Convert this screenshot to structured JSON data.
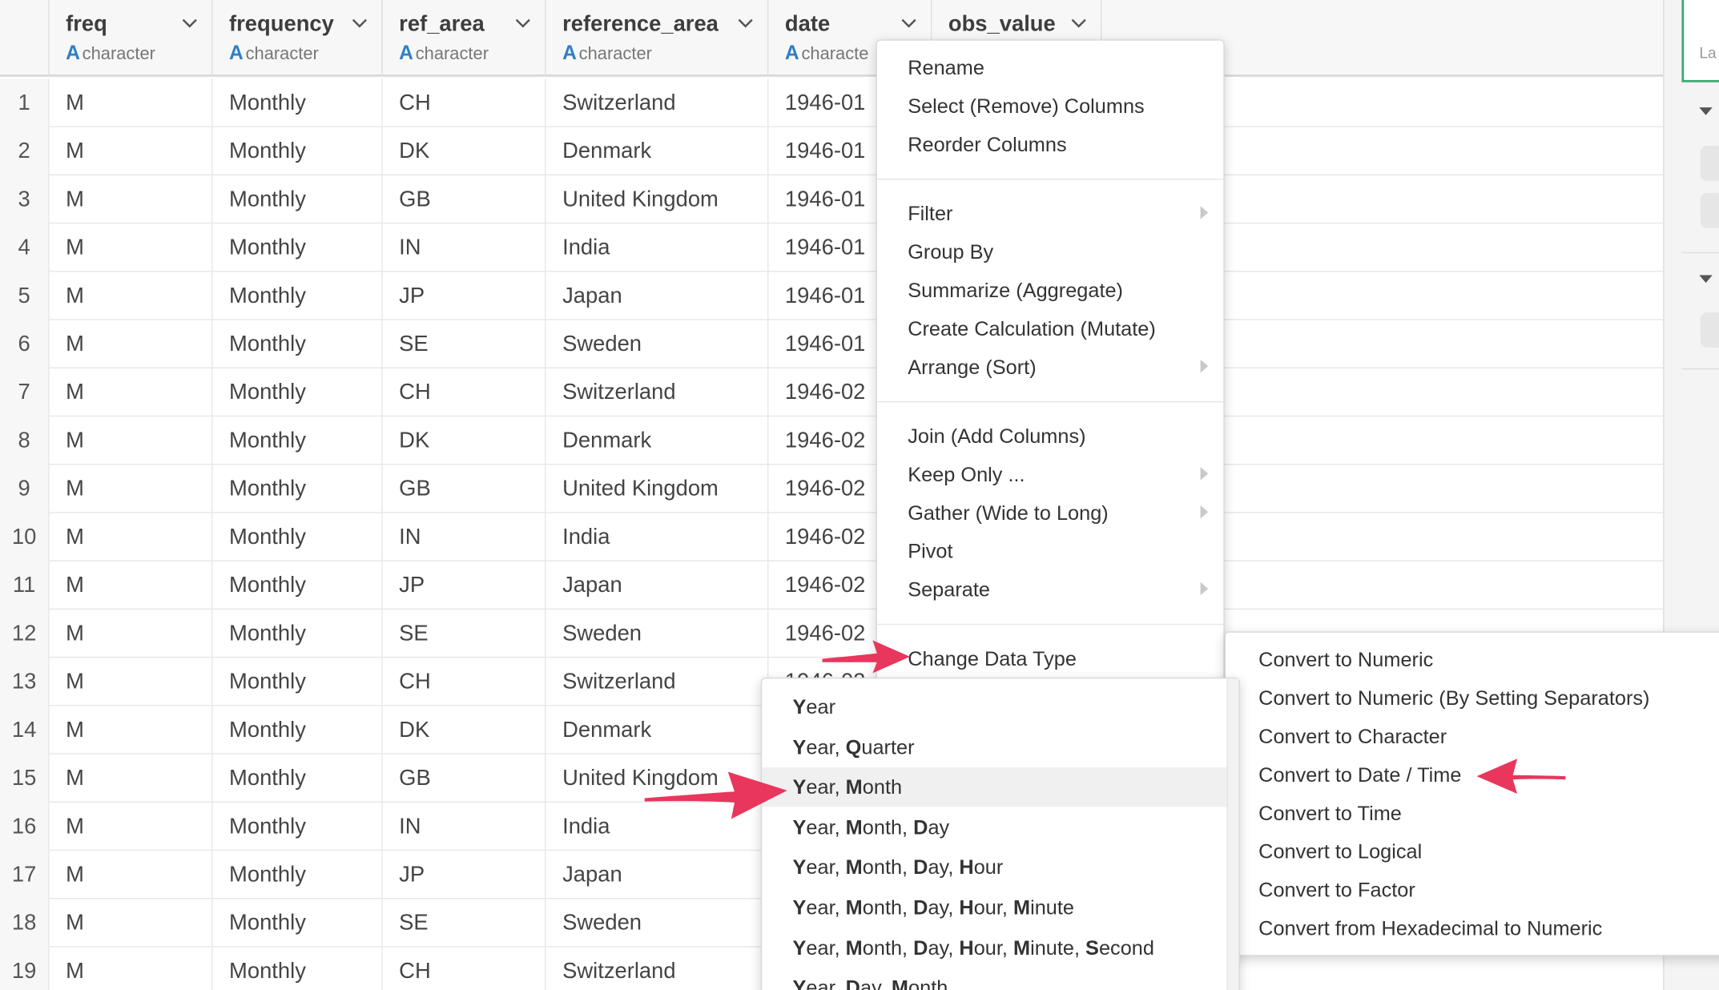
{
  "columns": [
    {
      "name": "freq",
      "type": "character"
    },
    {
      "name": "frequency",
      "type": "character"
    },
    {
      "name": "ref_area",
      "type": "character"
    },
    {
      "name": "reference_area",
      "type": "character"
    },
    {
      "name": "date",
      "type": "characte"
    },
    {
      "name": "obs_value",
      "type": ""
    }
  ],
  "type_glyph": "A",
  "rows": [
    {
      "n": "1",
      "freq": "M",
      "frequency": "Monthly",
      "ref_area": "CH",
      "reference_area": "Switzerland",
      "date": "1946-01"
    },
    {
      "n": "2",
      "freq": "M",
      "frequency": "Monthly",
      "ref_area": "DK",
      "reference_area": "Denmark",
      "date": "1946-01"
    },
    {
      "n": "3",
      "freq": "M",
      "frequency": "Monthly",
      "ref_area": "GB",
      "reference_area": "United Kingdom",
      "date": "1946-01"
    },
    {
      "n": "4",
      "freq": "M",
      "frequency": "Monthly",
      "ref_area": "IN",
      "reference_area": "India",
      "date": "1946-01"
    },
    {
      "n": "5",
      "freq": "M",
      "frequency": "Monthly",
      "ref_area": "JP",
      "reference_area": "Japan",
      "date": "1946-01"
    },
    {
      "n": "6",
      "freq": "M",
      "frequency": "Monthly",
      "ref_area": "SE",
      "reference_area": "Sweden",
      "date": "1946-01"
    },
    {
      "n": "7",
      "freq": "M",
      "frequency": "Monthly",
      "ref_area": "CH",
      "reference_area": "Switzerland",
      "date": "1946-02"
    },
    {
      "n": "8",
      "freq": "M",
      "frequency": "Monthly",
      "ref_area": "DK",
      "reference_area": "Denmark",
      "date": "1946-02"
    },
    {
      "n": "9",
      "freq": "M",
      "frequency": "Monthly",
      "ref_area": "GB",
      "reference_area": "United Kingdom",
      "date": "1946-02"
    },
    {
      "n": "10",
      "freq": "M",
      "frequency": "Monthly",
      "ref_area": "IN",
      "reference_area": "India",
      "date": "1946-02"
    },
    {
      "n": "11",
      "freq": "M",
      "frequency": "Monthly",
      "ref_area": "JP",
      "reference_area": "Japan",
      "date": "1946-02"
    },
    {
      "n": "12",
      "freq": "M",
      "frequency": "Monthly",
      "ref_area": "SE",
      "reference_area": "Sweden",
      "date": "1946-02"
    },
    {
      "n": "13",
      "freq": "M",
      "frequency": "Monthly",
      "ref_area": "CH",
      "reference_area": "Switzerland",
      "date": "1946-02"
    },
    {
      "n": "14",
      "freq": "M",
      "frequency": "Monthly",
      "ref_area": "DK",
      "reference_area": "Denmark",
      "date": ""
    },
    {
      "n": "15",
      "freq": "M",
      "frequency": "Monthly",
      "ref_area": "GB",
      "reference_area": "United Kingdom",
      "date": ""
    },
    {
      "n": "16",
      "freq": "M",
      "frequency": "Monthly",
      "ref_area": "IN",
      "reference_area": "India",
      "date": ""
    },
    {
      "n": "17",
      "freq": "M",
      "frequency": "Monthly",
      "ref_area": "JP",
      "reference_area": "Japan",
      "date": ""
    },
    {
      "n": "18",
      "freq": "M",
      "frequency": "Monthly",
      "ref_area": "SE",
      "reference_area": "Sweden",
      "date": ""
    },
    {
      "n": "19",
      "freq": "M",
      "frequency": "Monthly",
      "ref_area": "CH",
      "reference_area": "Switzerland",
      "date": ""
    }
  ],
  "column_menu": {
    "items": [
      "Rename",
      "Select (Remove) Columns",
      "Reorder Columns",
      "Filter",
      "Group By",
      "Summarize (Aggregate)",
      "Create Calculation (Mutate)",
      "Arrange (Sort)",
      "Join (Add Columns)",
      "Keep Only ...",
      "Gather (Wide to Long)",
      "Pivot",
      "Separate",
      "Change Data Type"
    ]
  },
  "type_menu": {
    "items": [
      "Convert to Numeric",
      "Convert to Numeric (By Setting Separators)",
      "Convert to Character",
      "Convert to Date / Time",
      "Convert to Time",
      "Convert to Logical",
      "Convert to Factor",
      "Convert from Hexadecimal to Numeric"
    ]
  },
  "datetime_menu": {
    "items": [
      [
        {
          "b": "Y",
          "t": "ear"
        }
      ],
      [
        {
          "b": "Y",
          "t": "ear, "
        },
        {
          "b": "Q",
          "t": "uarter"
        }
      ],
      [
        {
          "b": "Y",
          "t": "ear, "
        },
        {
          "b": "M",
          "t": "onth"
        }
      ],
      [
        {
          "b": "Y",
          "t": "ear, "
        },
        {
          "b": "M",
          "t": "onth, "
        },
        {
          "b": "D",
          "t": "ay"
        }
      ],
      [
        {
          "b": "Y",
          "t": "ear, "
        },
        {
          "b": "M",
          "t": "onth, "
        },
        {
          "b": "D",
          "t": "ay, "
        },
        {
          "b": "H",
          "t": "our"
        }
      ],
      [
        {
          "b": "Y",
          "t": "ear, "
        },
        {
          "b": "M",
          "t": "onth, "
        },
        {
          "b": "D",
          "t": "ay, "
        },
        {
          "b": "H",
          "t": "our, "
        },
        {
          "b": "M",
          "t": "inute"
        }
      ],
      [
        {
          "b": "Y",
          "t": "ear, "
        },
        {
          "b": "M",
          "t": "onth, "
        },
        {
          "b": "D",
          "t": "ay, "
        },
        {
          "b": "H",
          "t": "our, "
        },
        {
          "b": "M",
          "t": "inute, "
        },
        {
          "b": "S",
          "t": "econd"
        }
      ],
      [
        {
          "b": "Y",
          "t": "ear, "
        },
        {
          "b": "D",
          "t": "ay, "
        },
        {
          "b": "M",
          "t": "onth"
        }
      ]
    ]
  },
  "right_panel": {
    "label": "La"
  },
  "colors": {
    "accent_arrow": "#e8365d",
    "type_glyph": "#2d7fc8",
    "highlight": "#f0f0f0"
  }
}
